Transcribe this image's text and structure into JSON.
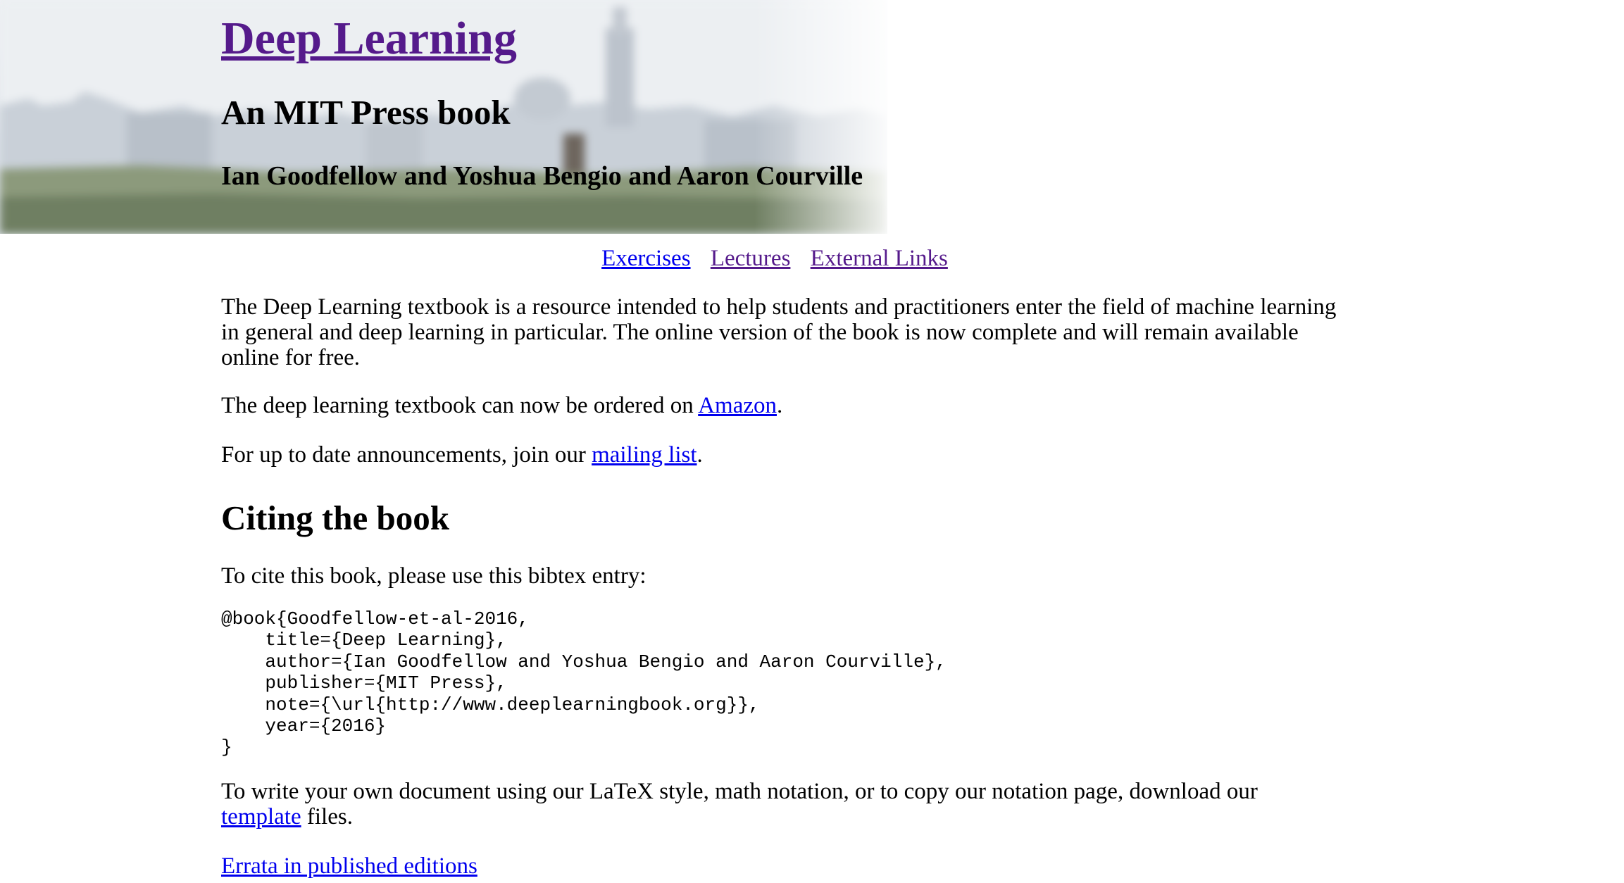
{
  "header": {
    "title": "Deep Learning",
    "subtitle": "An MIT Press book",
    "authors": "Ian Goodfellow and Yoshua Bengio and Aaron Courville"
  },
  "nav": {
    "items": [
      {
        "label": "Exercises"
      },
      {
        "label": "Lectures"
      },
      {
        "label": "External Links"
      }
    ]
  },
  "main": {
    "intro": "The Deep Learning textbook is a resource intended to help students and practitioners enter the field of machine learning in general and deep learning in particular. The online version of the book is now complete and will remain available online for free.",
    "amazon_prefix": "The deep learning textbook can now be ordered on ",
    "amazon_link": "Amazon",
    "amazon_suffix": ".",
    "mailing_prefix": "For up to date announcements, join our ",
    "mailing_link": "mailing list",
    "mailing_suffix": ".",
    "citing_heading": "Citing the book",
    "cite_intro": "To cite this book, please use this bibtex entry:",
    "bibtex": "@book{Goodfellow-et-al-2016,\n    title={Deep Learning},\n    author={Ian Goodfellow and Yoshua Bengio and Aaron Courville},\n    publisher={MIT Press},\n    note={\\url{http://www.deeplearningbook.org}},\n    year={2016}\n}",
    "template_prefix": "To write your own document using our LaTeX style, math notation, or to copy our notation page, download our ",
    "template_link": "template",
    "template_suffix": " files.",
    "errata_link": "Errata in published editions"
  },
  "colors": {
    "visited_link": "#551a8b",
    "unvisited_link": "#0000ee"
  }
}
